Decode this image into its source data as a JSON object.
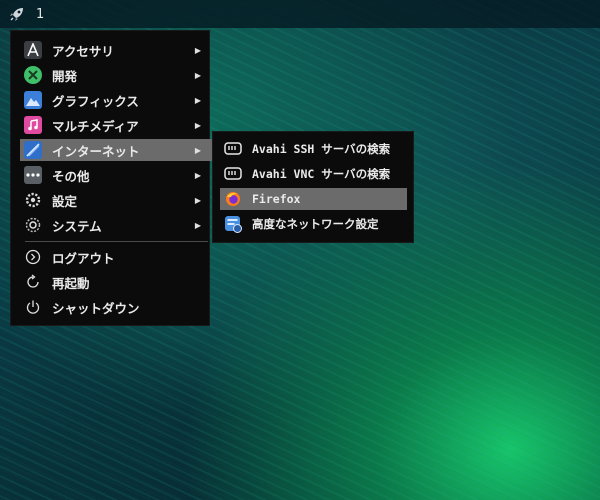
{
  "panel": {
    "workspace": "1"
  },
  "menu": {
    "items": [
      {
        "label": "アクセサリ",
        "icon": "accessories-icon",
        "has_submenu": true
      },
      {
        "label": "開発",
        "icon": "development-icon",
        "has_submenu": true
      },
      {
        "label": "グラフィックス",
        "icon": "graphics-icon",
        "has_submenu": true
      },
      {
        "label": "マルチメディア",
        "icon": "multimedia-icon",
        "has_submenu": true
      },
      {
        "label": "インターネット",
        "icon": "internet-icon",
        "has_submenu": true,
        "active": true
      },
      {
        "label": "その他",
        "icon": "other-icon",
        "has_submenu": true
      },
      {
        "label": "設定",
        "icon": "settings-icon",
        "has_submenu": true
      },
      {
        "label": "システム",
        "icon": "system-icon",
        "has_submenu": true
      },
      {
        "label": "ログアウト",
        "icon": "logout-icon",
        "has_submenu": false
      },
      {
        "label": "再起動",
        "icon": "restart-icon",
        "has_submenu": false
      },
      {
        "label": "シャットダウン",
        "icon": "shutdown-icon",
        "has_submenu": false
      }
    ],
    "arrow": "▶"
  },
  "submenu": {
    "items": [
      {
        "label": "Avahi SSH サーバの検索",
        "icon": "network-server-icon"
      },
      {
        "label": "Avahi VNC サーバの検索",
        "icon": "network-server-icon"
      },
      {
        "label": "Firefox",
        "icon": "firefox-icon",
        "active": true
      },
      {
        "label": "高度なネットワーク設定",
        "icon": "network-settings-icon"
      }
    ]
  },
  "colors": {
    "menu_bg": "#0b0b0b",
    "highlight": "#6b6b6b",
    "text": "#eaeaea"
  }
}
